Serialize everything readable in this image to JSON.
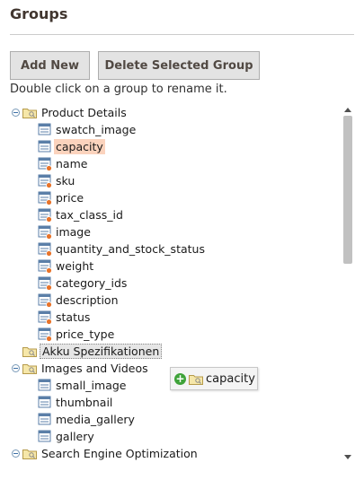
{
  "header": {
    "title": "Groups"
  },
  "toolbar": {
    "add_label": "Add New",
    "delete_label": "Delete Selected Group"
  },
  "hint": "Double click on a group to rename it.",
  "tree": {
    "groups": [
      {
        "label": "Product Details",
        "expanded": true,
        "items": [
          {
            "label": "swatch_image",
            "system": false
          },
          {
            "label": "capacity",
            "system": false,
            "selected": true
          },
          {
            "label": "name",
            "system": true
          },
          {
            "label": "sku",
            "system": true
          },
          {
            "label": "price",
            "system": true
          },
          {
            "label": "tax_class_id",
            "system": true
          },
          {
            "label": "image",
            "system": true
          },
          {
            "label": "quantity_and_stock_status",
            "system": true
          },
          {
            "label": "weight",
            "system": true
          },
          {
            "label": "category_ids",
            "system": true
          },
          {
            "label": "description",
            "system": true
          },
          {
            "label": "status",
            "system": true
          },
          {
            "label": "price_type",
            "system": true
          }
        ]
      },
      {
        "label": "Akku Spezifikationen",
        "expanded": false,
        "hovered": true,
        "items": []
      },
      {
        "label": "Images and Videos",
        "expanded": true,
        "items": [
          {
            "label": "small_image",
            "system": false
          },
          {
            "label": "thumbnail",
            "system": false
          },
          {
            "label": "media_gallery",
            "system": false
          },
          {
            "label": "gallery",
            "system": false
          }
        ]
      },
      {
        "label": "Search Engine Optimization",
        "expanded": true,
        "items": []
      }
    ]
  },
  "drag_ghost": {
    "label": "capacity",
    "icon": "add-icon"
  },
  "colors": {
    "selected_bg": "#fbd3bd",
    "button_bg": "#e3e3e3",
    "title": "#41362f"
  }
}
